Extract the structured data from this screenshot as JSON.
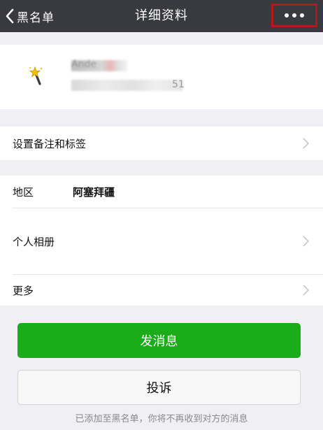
{
  "navbar": {
    "back_label": "黑名单",
    "title": "详细资料"
  },
  "profile": {
    "name_partial": "Ande",
    "id_partial": "51"
  },
  "rows": {
    "remark": {
      "label": "设置备注和标签"
    },
    "region": {
      "label": "地区",
      "value": "阿塞拜疆"
    },
    "album": {
      "label": "个人相册"
    },
    "more": {
      "label": "更多"
    }
  },
  "buttons": {
    "send_message": "发消息",
    "report": "投诉"
  },
  "notice": "已添加至黑名单，你将不再收到对方的消息",
  "colors": {
    "navbar_bg": "#393a3f",
    "primary_green": "#1aad19",
    "highlight_red": "#b3191b"
  },
  "icons": {
    "back": "chevron-left-icon",
    "more": "more-dots-icon",
    "avatar": "magic-wand-icon",
    "row_arrow": "chevron-right-icon"
  }
}
